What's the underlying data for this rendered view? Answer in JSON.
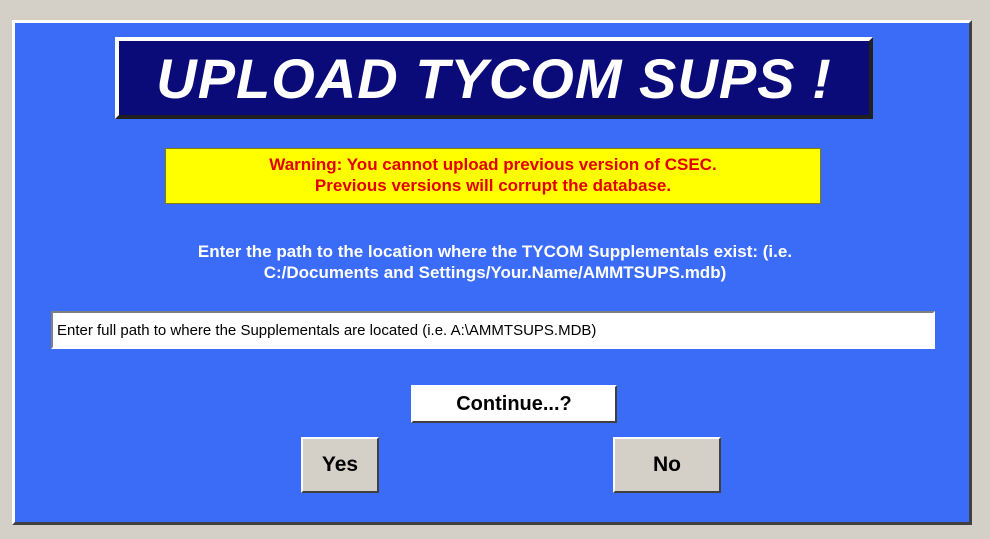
{
  "dialog": {
    "title": "UPLOAD TYCOM SUPS !",
    "warning": {
      "line1": "Warning:  You cannot upload previous version of CSEC.",
      "line2": "Previous versions will corrupt the database."
    },
    "instruction": {
      "line1": "Enter the path to the location where the TYCOM Supplementals exist: (i.e.",
      "line2": "C:/Documents and Settings/Your.Name/AMMTSUPS.mdb)"
    },
    "path_input": {
      "value": "Enter full path to where the Supplementals are located (i.e. A:\\AMMTSUPS.MDB)"
    },
    "buttons": {
      "continue_label": "Continue...?",
      "yes_label": "Yes",
      "no_label": "No"
    }
  },
  "colors": {
    "dialog_background": "#3b6cf7",
    "title_background": "#0a0a78",
    "warning_background": "#ffff00",
    "warning_text": "#e00000"
  }
}
